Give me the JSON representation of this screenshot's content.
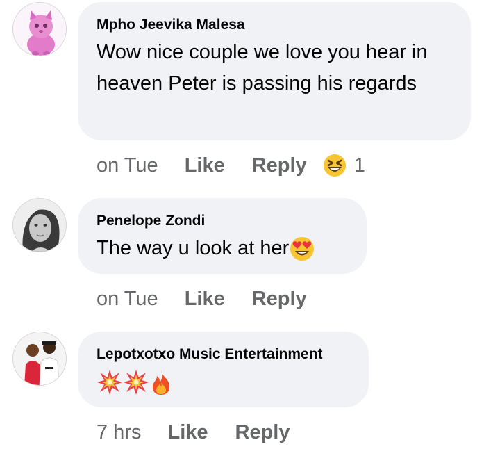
{
  "comments": [
    {
      "author": "Mpho Jeevika Malesa",
      "text": "Wow nice couple we love you hear in heaven Peter is passing his regards",
      "time": "on Tue",
      "like": "Like",
      "reply": "Reply",
      "reaction_icon": "laughing-squint-emoji",
      "reaction_count": "1"
    },
    {
      "author": "Penelope Zondi",
      "text": "The way u look at her",
      "emoji": "heart-eyes-emoji",
      "time": "on Tue",
      "like": "Like",
      "reply": "Reply"
    },
    {
      "author": "Lepotxotxo Music Entertainment",
      "emoji": [
        "collision-emoji",
        "collision-emoji",
        "fire-emoji"
      ],
      "time": "7 hrs",
      "like": "Like",
      "reply": "Reply"
    }
  ],
  "colors": {
    "bubble_bg": "#f0f2f5",
    "author_text": "#050505",
    "meta_text": "#65676b"
  }
}
